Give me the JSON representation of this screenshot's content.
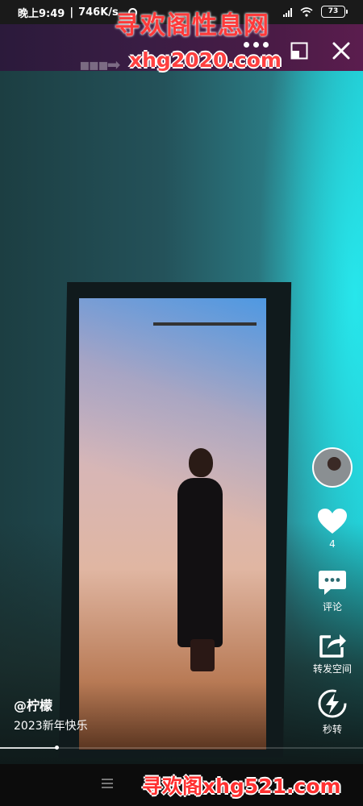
{
  "status_bar": {
    "time": "晚上9:49",
    "net_speed": "746K/s",
    "battery": "73"
  },
  "watermarks": {
    "top_title": "寻欢阁性息网",
    "top_url": "xhg2020.com",
    "bottom": "寻欢阁xhg521.com"
  },
  "actions": {
    "like_count": "4",
    "comment_label": "评论",
    "share_label": "转发空间",
    "flash_label": "秒转"
  },
  "post": {
    "author": "@柠檬",
    "caption": "2023新年快乐"
  },
  "playback": {
    "progress_fraction": 0.155
  },
  "icons": {
    "top_bar": [
      "more-icon",
      "pip-icon",
      "close-icon"
    ],
    "rail": [
      "heart-icon",
      "comment-icon",
      "share-icon",
      "flash-icon"
    ],
    "nav": [
      "menu-icon"
    ]
  }
}
